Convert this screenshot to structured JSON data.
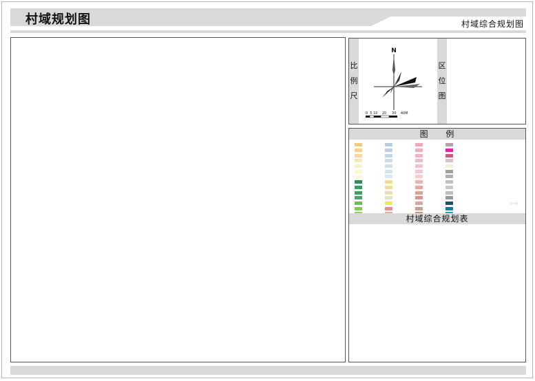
{
  "header": {
    "title": "村域规划图",
    "subtitle": "村域综合规划图"
  },
  "info_panel": {
    "scale_label_chars": [
      "比",
      "例",
      "尺"
    ],
    "location_label_chars": [
      "区",
      "位",
      "图"
    ],
    "north_label": "N",
    "scale_ticks": "0  5 10    20     30    40M"
  },
  "legend": {
    "title_chars": [
      "图",
      "例"
    ],
    "columns": [
      [
        {
          "color": "#f7c97a",
          "label": ""
        },
        {
          "color": "#f9d089",
          "label": ""
        },
        {
          "color": "#fbd89a",
          "label": ""
        },
        {
          "color": "#fde6b5",
          "label": ""
        },
        {
          "color": "#fef0c5",
          "label": ""
        },
        {
          "color": "#fff5cf",
          "label": ""
        },
        {
          "color": "#fffbdc",
          "label": ""
        },
        {
          "color": "#2e8b57",
          "label": ""
        },
        {
          "color": "#3a9b5e",
          "label": ""
        },
        {
          "color": "#3fa060",
          "label": ""
        },
        {
          "color": "#48a865",
          "label": ""
        },
        {
          "color": "#6cc04a",
          "label": ""
        },
        {
          "color": "#7ecb4e",
          "label": ""
        },
        {
          "color": "#9ad358",
          "label": ""
        },
        {
          "color": "#b0c7e0",
          "label": ""
        }
      ],
      [
        {
          "color": "#b7cde4",
          "label": ""
        },
        {
          "color": "#bcd1e6",
          "label": ""
        },
        {
          "color": "#c2d6e9",
          "label": ""
        },
        {
          "color": "#c7dbeb",
          "label": ""
        },
        {
          "color": "#cde0ee",
          "label": ""
        },
        {
          "color": "#d2e4f0",
          "label": ""
        },
        {
          "color": "#d9e8f2",
          "label": ""
        },
        {
          "color": "#f2d98c",
          "label": ""
        },
        {
          "color": "#f5dd99",
          "label": ""
        },
        {
          "color": "#e8e0b4",
          "label": ""
        },
        {
          "color": "#e0e6c0",
          "label": ""
        },
        {
          "color": "#f4e94b",
          "label": ""
        },
        {
          "color": "#f08a8a",
          "label": ""
        },
        {
          "color": "#f4a3a3",
          "label": ""
        },
        {
          "color": "#f6b3b3",
          "label": ""
        }
      ],
      [
        {
          "color": "#f2a7b5",
          "label": ""
        },
        {
          "color": "#f3adba",
          "label": ""
        },
        {
          "color": "#f4b3bf",
          "label": ""
        },
        {
          "color": "#f5b9c4",
          "label": ""
        },
        {
          "color": "#f6bfc9",
          "label": ""
        },
        {
          "color": "#f7c5ce",
          "label": ""
        },
        {
          "color": "#f8cbd3",
          "label": ""
        },
        {
          "color": "#f0b1a8",
          "label": ""
        },
        {
          "color": "#eca79d",
          "label": ""
        },
        {
          "color": "#e99d93",
          "label": ""
        },
        {
          "color": "#e59389",
          "label": ""
        },
        {
          "color": "#d4a89a",
          "label": ""
        },
        {
          "color": "#c9a090",
          "label": ""
        },
        {
          "color": "#be9888",
          "label": ""
        },
        {
          "color": "#b49080",
          "label": ""
        }
      ],
      [
        {
          "color": "#b8a0a8",
          "label": ""
        },
        {
          "color": "#e620a0",
          "label": ""
        },
        {
          "color": "#c75a7a",
          "label": ""
        },
        {
          "color": "#d9c0d0",
          "label": ""
        },
        {
          "color": "#eaf4d6",
          "label": ""
        },
        {
          "color": "#a0a0a0",
          "label": ""
        },
        {
          "color": "#b0b0b0",
          "label": ""
        },
        {
          "color": "#c0c0c0",
          "label": ""
        },
        {
          "color": "#c8c8c8",
          "label": ""
        },
        {
          "color": "#bdbdbd",
          "label": ""
        },
        {
          "color": "#9a9a9a",
          "label": ""
        },
        {
          "color": "#1f4e6e",
          "label": ""
        },
        {
          "color": "#1478a8",
          "label": ""
        },
        {
          "color": "#1aa0c8",
          "label": ""
        },
        {
          "color": "#1a8ab8",
          "label": ""
        }
      ]
    ]
  },
  "table_panel": {
    "title": "村域综合规划表"
  }
}
